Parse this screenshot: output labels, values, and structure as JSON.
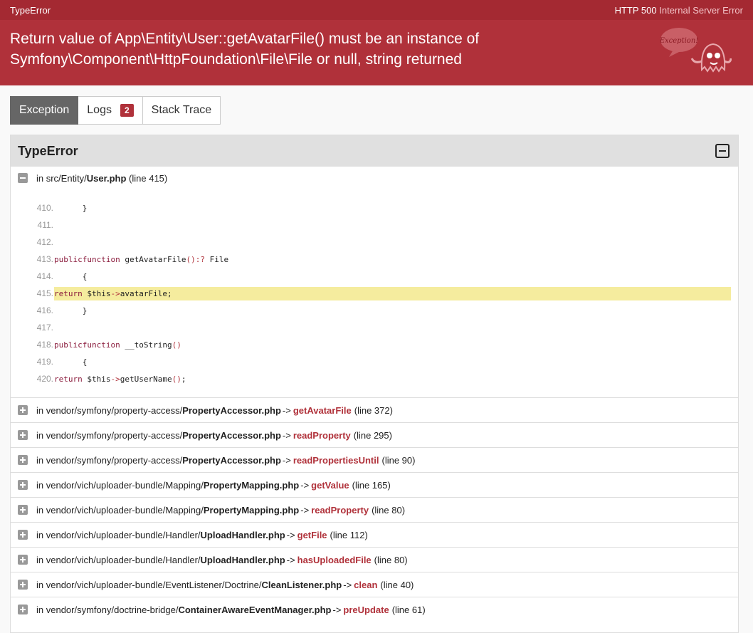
{
  "topbar": {
    "exception_class": "TypeError",
    "status_code": "HTTP 500",
    "status_text": "Internal Server Error"
  },
  "header": {
    "message": "Return value of App\\Entity\\User::getAvatarFile() must be an instance of Symfony\\Component\\HttpFoundation\\File\\File or null, string returned",
    "ghost_text": "Exception!"
  },
  "tabs": [
    {
      "label": "Exception",
      "active": true
    },
    {
      "label": "Logs",
      "badge": "2"
    },
    {
      "label": "Stack Trace"
    }
  ],
  "panel": {
    "title": "TypeError",
    "first_frame": {
      "prefix": "in src/Entity/",
      "file": "User.php",
      "line": "(line 415)"
    },
    "code": [
      {
        "n": "410.",
        "t": "    }"
      },
      {
        "n": "411.",
        "t": ""
      },
      {
        "n": "412.",
        "t": ""
      },
      {
        "n": "413.",
        "t": "    public function getAvatarFile() : ? File"
      },
      {
        "n": "414.",
        "t": "    {"
      },
      {
        "n": "415.",
        "t": "        return $this->avatarFile;"
      },
      {
        "n": "416.",
        "t": "    }"
      },
      {
        "n": "417.",
        "t": ""
      },
      {
        "n": "418.",
        "t": "    public function __toString()"
      },
      {
        "n": "419.",
        "t": "    {"
      },
      {
        "n": "420.",
        "t": "        return $this->getUserName();"
      }
    ],
    "frames": [
      {
        "prefix": "in vendor/symfony/property-access/",
        "file": "PropertyAccessor.php",
        "fn": "getAvatarFile",
        "line": "(line 372)"
      },
      {
        "prefix": "in vendor/symfony/property-access/",
        "file": "PropertyAccessor.php",
        "fn": "readProperty",
        "line": "(line 295)"
      },
      {
        "prefix": "in vendor/symfony/property-access/",
        "file": "PropertyAccessor.php",
        "fn": "readPropertiesUntil",
        "line": "(line 90)"
      },
      {
        "prefix": "in vendor/vich/uploader-bundle/Mapping/",
        "file": "PropertyMapping.php",
        "fn": "getValue",
        "line": "(line 165)"
      },
      {
        "prefix": "in vendor/vich/uploader-bundle/Mapping/",
        "file": "PropertyMapping.php",
        "fn": "readProperty",
        "line": "(line 80)"
      },
      {
        "prefix": "in vendor/vich/uploader-bundle/Handler/",
        "file": "UploadHandler.php",
        "fn": "getFile",
        "line": "(line 112)"
      },
      {
        "prefix": "in vendor/vich/uploader-bundle/Handler/",
        "file": "UploadHandler.php",
        "fn": "hasUploadedFile",
        "line": "(line 80)"
      },
      {
        "prefix": "in vendor/vich/uploader-bundle/EventListener/Doctrine/",
        "file": "CleanListener.php",
        "fn": "clean",
        "line": "(line 40)"
      },
      {
        "prefix": "in vendor/symfony/doctrine-bridge/",
        "file": "ContainerAwareEventManager.php",
        "fn": "preUpdate",
        "line": "(line 61)"
      }
    ]
  },
  "colors": {
    "brand": "#b0313a",
    "topbar": "#a42932",
    "highlight": "#f5ec9e"
  }
}
